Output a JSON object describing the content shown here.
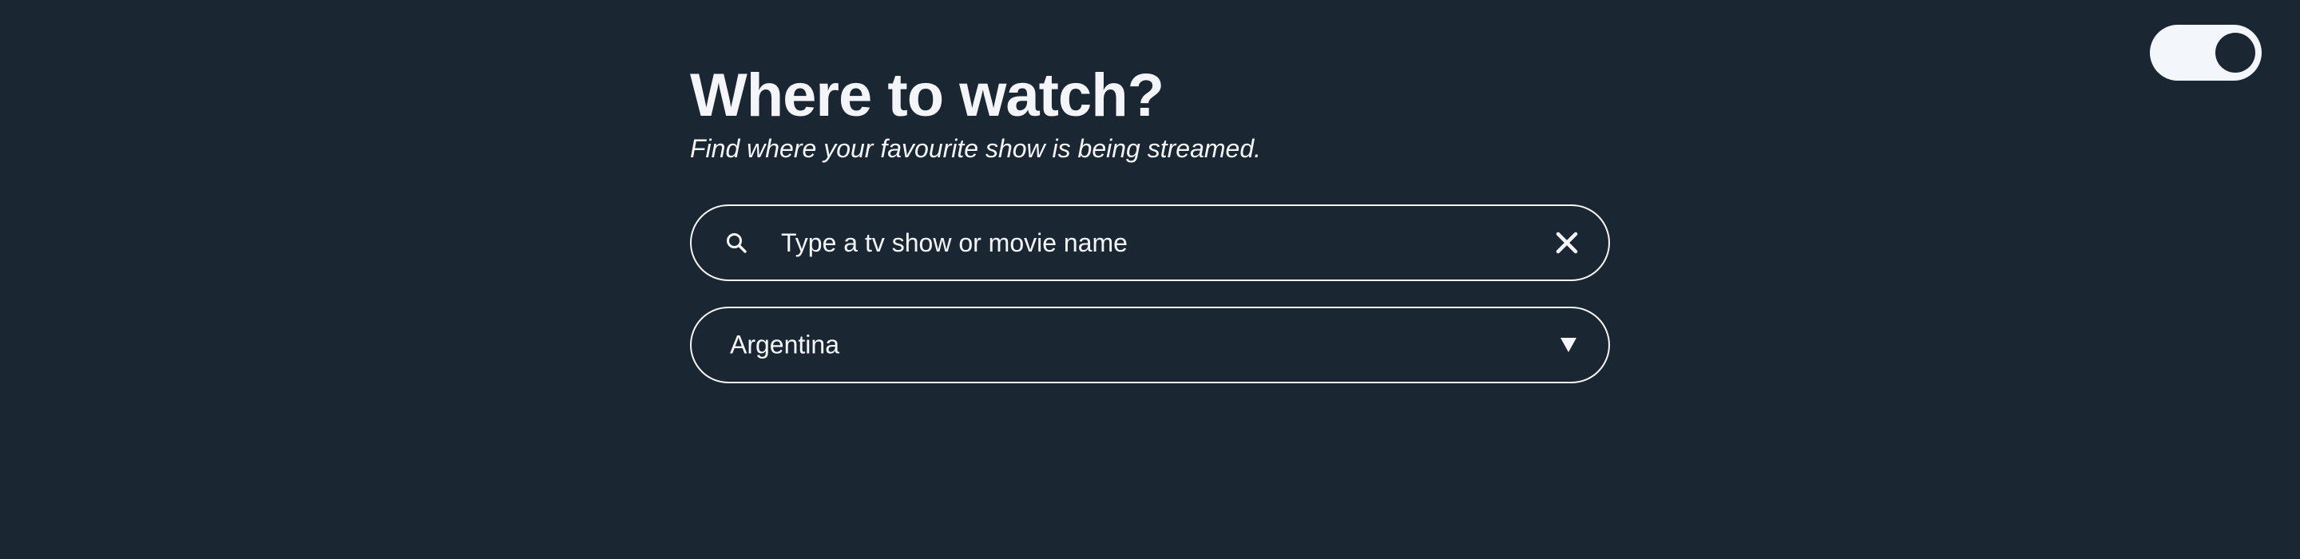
{
  "header": {
    "title": "Where to watch?",
    "subtitle": "Find where your favourite show is being streamed."
  },
  "search": {
    "placeholder": "Type a tv show or movie name",
    "value": "",
    "icon": "search-icon",
    "clear_icon": "close-icon"
  },
  "country_select": {
    "selected": "Argentina",
    "icon": "caret-down-icon"
  },
  "theme_toggle": {
    "state": "on",
    "icon": "toggle-switch"
  },
  "colors": {
    "background": "#1a2733",
    "foreground": "#f3f5f8"
  }
}
